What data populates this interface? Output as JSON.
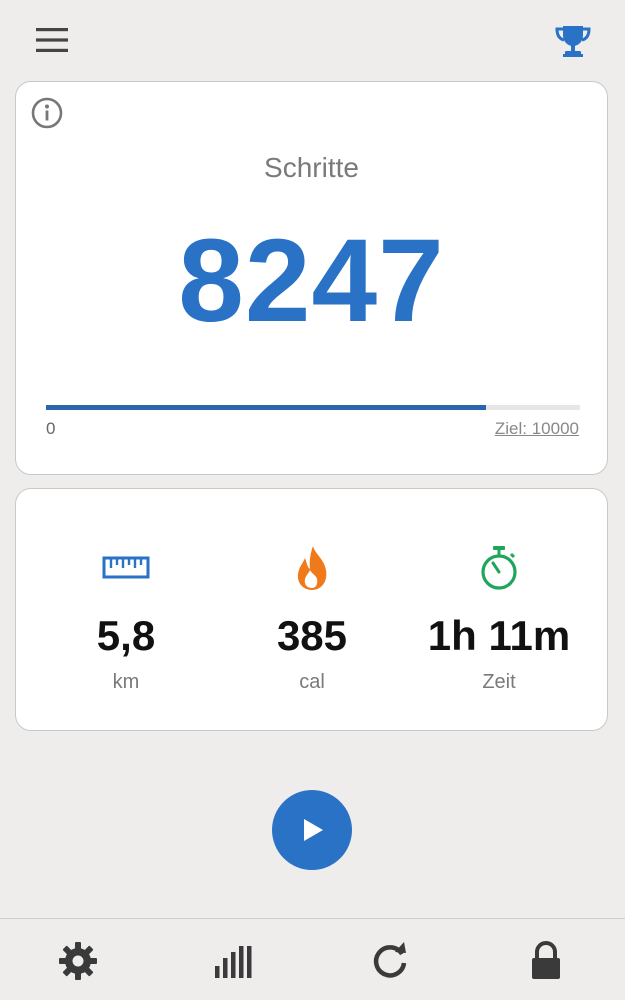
{
  "header": {
    "menu_icon": "hamburger-menu-icon",
    "trophy_icon": "trophy-icon",
    "trophy_color": "#2a72c5"
  },
  "steps": {
    "info_icon": "info-icon",
    "label": "Schritte",
    "value": "8247",
    "progress_fraction": 0.824,
    "range_min": "0",
    "goal_label": "Ziel: 10000",
    "value_color": "#2a72c5"
  },
  "stats": {
    "distance": {
      "icon": "ruler-icon",
      "value": "5,8",
      "unit": "km",
      "color": "#2a72c5"
    },
    "calories": {
      "icon": "flame-icon",
      "value": "385",
      "unit": "cal",
      "color": "#f07a1a"
    },
    "time": {
      "icon": "stopwatch-icon",
      "value": "1h 11m",
      "unit": "Zeit",
      "color": "#1ea65a"
    }
  },
  "actions": {
    "play_icon": "play-icon",
    "play_color": "#2a72c5"
  },
  "nav": {
    "items": [
      {
        "icon": "gear-icon"
      },
      {
        "icon": "bar-chart-icon"
      },
      {
        "icon": "refresh-icon"
      },
      {
        "icon": "lock-icon"
      }
    ]
  }
}
